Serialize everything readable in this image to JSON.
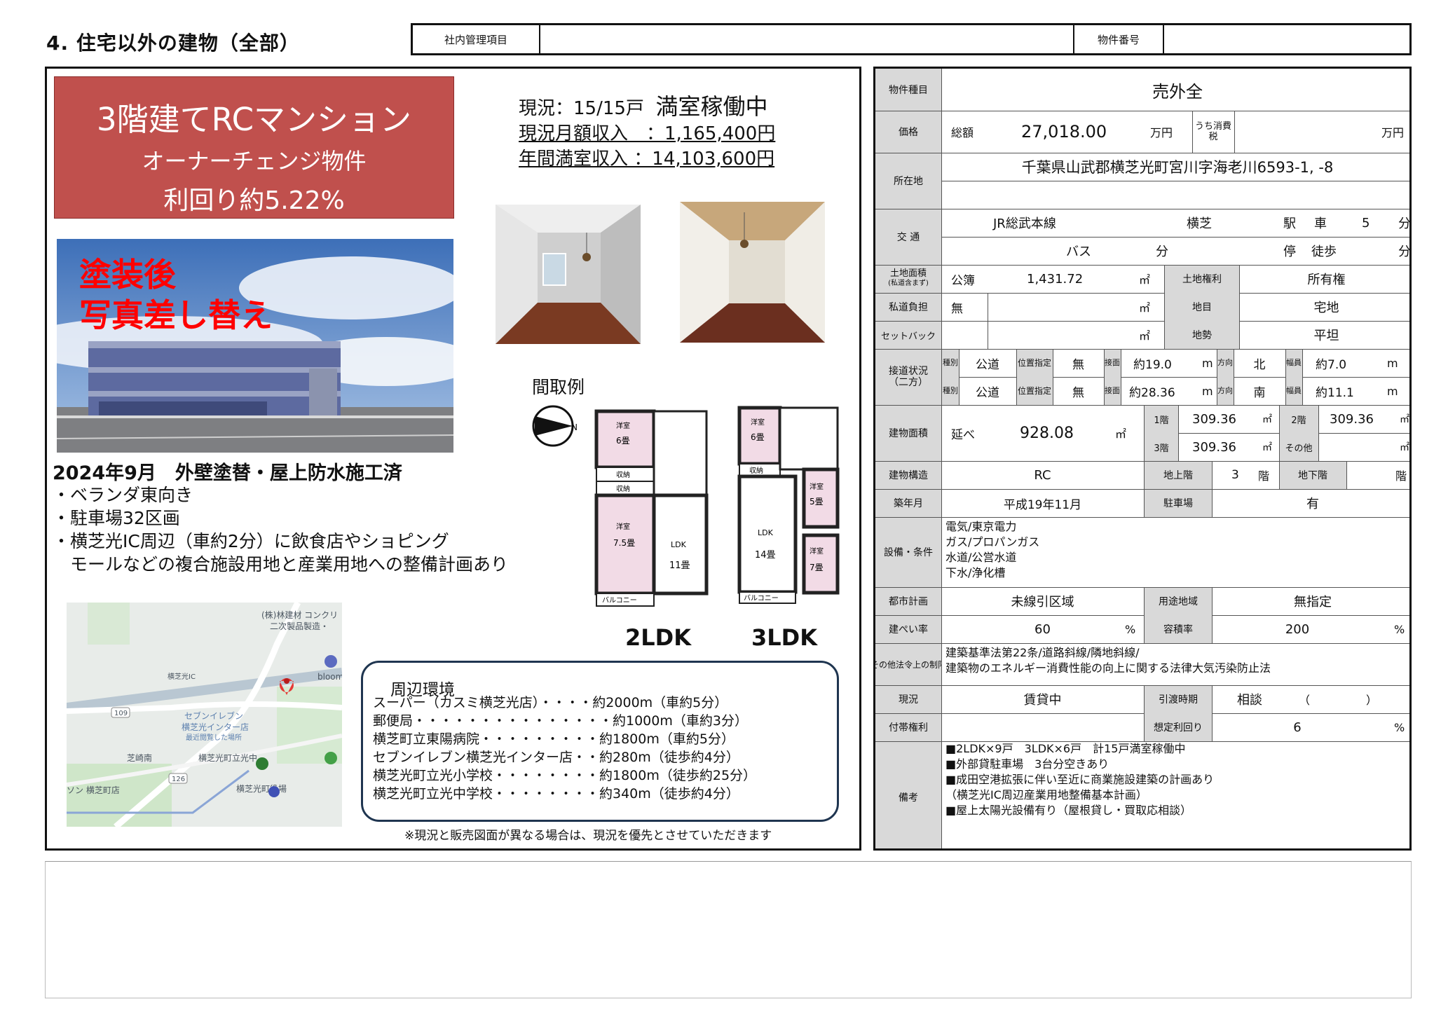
{
  "header": {
    "title": "4. 住宅以外の建物（全部）",
    "internal_label": "社内管理項目",
    "internal_value": "",
    "property_no_label": "物件番号",
    "property_no_value": ""
  },
  "headline": {
    "line1": "3階建てRCマンション",
    "line2": "オーナーチェンジ物件",
    "line3": "利回り約5.22%"
  },
  "income": {
    "status_prefix": "現況：15/15戸",
    "status_big": "満室稼働中",
    "monthly": "現況月額収入　：1,165,400円",
    "annual": "年間満室収入 ：14,103,600円"
  },
  "photo_overlay": {
    "line1": "塗装後",
    "line2": "写真差し替え"
  },
  "works": "2024年9月　外壁塗替・屋上防水施工済",
  "bullets": [
    "・ベランダ東向き",
    "・駐車場32区画",
    "・横芝光IC周辺（車約2分）に飲食店やショピング",
    "　モールなどの複合施設用地と産業用地への整備計画あり"
  ],
  "floorplan": {
    "label": "間取例",
    "plan1": "2LDK",
    "plan2": "3LDK",
    "plan1_rooms": [
      "洋室",
      "6畳",
      "収納",
      "収納",
      "洋室",
      "7.5畳",
      "LDK",
      "11畳",
      "バルコニー"
    ],
    "plan2_rooms": [
      "洋室",
      "6畳",
      "収納",
      "LDK",
      "14畳",
      "洋室",
      "5畳",
      "洋室",
      "7畳",
      "バルコニー"
    ]
  },
  "map": {
    "labels": [
      "(株)林建材 コンクリ",
      "二次製品製造・",
      "横芝光IC",
      "bloom",
      "セブンイレブン",
      "横芝光インター店",
      "最近閲覧した場所",
      "芝崎南",
      "横芝光町立光中",
      "ソン 横芝町店",
      "横芝光町役場",
      "109",
      "126"
    ]
  },
  "environment": {
    "title": "周辺環境",
    "items": [
      "スーパー（カスミ横芝光店）・・・・約2000m（車約5分）",
      "郵便局・・・・・・・・・・・・・・・約1000m（車約3分）",
      "横芝町立東陽病院・・・・・・・・・約1800m（車約5分）",
      "セブンイレブン横芝光インター店・・約280m（徒歩約4分）",
      "横芝光町立光小学校・・・・・・・・約1800m（徒歩約25分）",
      "横芝光町立光中学校・・・・・・・・約340m（徒歩約4分）"
    ],
    "note": "※現況と販売図面が異なる場合は、現況を優先とさせていただきます"
  },
  "table": {
    "type_label": "物件種目",
    "type_value": "売外全",
    "price_label": "価格",
    "total_label": "総額",
    "price_value": "27,018.00",
    "unit_man": "万円",
    "tax_label": "うち消費税",
    "tax_value": "",
    "tax_unit": "万円",
    "addr_label": "所在地",
    "addr_value": "千葉県山武郡横芝光町宮川字海老川6593-1, -8",
    "traffic_label": "交 通",
    "line": "JR総武本線",
    "station": "横芝",
    "eki": "駅",
    "car": "車",
    "car_min": "5",
    "fun": "分",
    "bus": "バス",
    "bus_fun": "分",
    "stop": "停",
    "walk": "徒歩",
    "walk_fun": "分",
    "land_label": "土地面積",
    "land_sub": "(私道含まず)",
    "koubo": "公簿",
    "land_area": "1,431.72",
    "m2": "㎡",
    "landright_label": "土地権利",
    "landright_value": "所有権",
    "private_label": "私道負担",
    "private_value": "無",
    "chimoku_label": "地目",
    "chimoku_value": "宅地",
    "setback_label": "セットバック",
    "chisei_label": "地勢",
    "chisei_value": "平坦",
    "road_label": "接道状況",
    "road_sub": "（二方）",
    "shubetsu": "種別",
    "ichi": "位置指定",
    "setsumen": "接面",
    "houkou": "方向",
    "fukuin": "幅員",
    "road1": {
      "kind": "公道",
      "shitei": "無",
      "len": "約19.0",
      "dir": "北",
      "width": "約7.0"
    },
    "road2": {
      "kind": "公道",
      "shitei": "無",
      "len": "約28.36",
      "dir": "南",
      "width": "約11.1"
    },
    "m": "m",
    "bldg_area_label": "建物面積",
    "nobe": "延べ",
    "total_area": "928.08",
    "f1_label": "1階",
    "f1": "309.36",
    "f2_label": "2階",
    "f2": "309.36",
    "f3_label": "3階",
    "f3": "309.36",
    "other_label": "その他",
    "other": "",
    "struct_label": "建物構造",
    "struct_value": "RC",
    "above_label": "地上階",
    "above_value": "3",
    "kai": "階",
    "below_label": "地下階",
    "below_value": "",
    "built_label": "築年月",
    "built_value": "平成19年11月",
    "parking_label": "駐車場",
    "parking_value": "有",
    "equip_label": "設備・条件",
    "equip": [
      "電気/東京電力",
      "ガス/プロパンガス",
      "水道/公営水道",
      "下水/浄化槽"
    ],
    "city_label": "都市計画",
    "city_value": "未線引区域",
    "use_label": "用途地域",
    "use_value": "無指定",
    "bcr_label": "建ぺい率",
    "bcr_value": "60",
    "pct": "%",
    "far_label": "容積率",
    "far_value": "200",
    "law_label": "その他法令上の制限",
    "law": [
      "建築基準法第22条/道路斜線/隣地斜線/",
      "建築物のエネルギー消費性能の向上に関する法律大気汚染防止法"
    ],
    "status_label": "現況",
    "status_value": "賃貸中",
    "handover_label": "引渡時期",
    "handover_value": "相談",
    "paren": "（　　　　　）",
    "rights_label": "付帯権利",
    "yield_label": "想定利回り",
    "yield_value": "6",
    "remarks_label": "備考",
    "remarks": [
      "■2LDK×9戸　3LDK×6戸　計15戸満室稼働中",
      "■外部貸駐車場　3台分空きあり",
      "■成田空港拡張に伴い至近に商業施設建築の計画あり",
      "（横芝光IC周辺産業用地整備基本計画）",
      "■屋上太陽光設備有り（屋根貸し・買取応相談）"
    ]
  },
  "colors": {
    "headline_bg": "#c0504d",
    "overlay_text": "#ff0000",
    "label_bg": "#d9d9d9",
    "env_border": "#1f3550"
  }
}
